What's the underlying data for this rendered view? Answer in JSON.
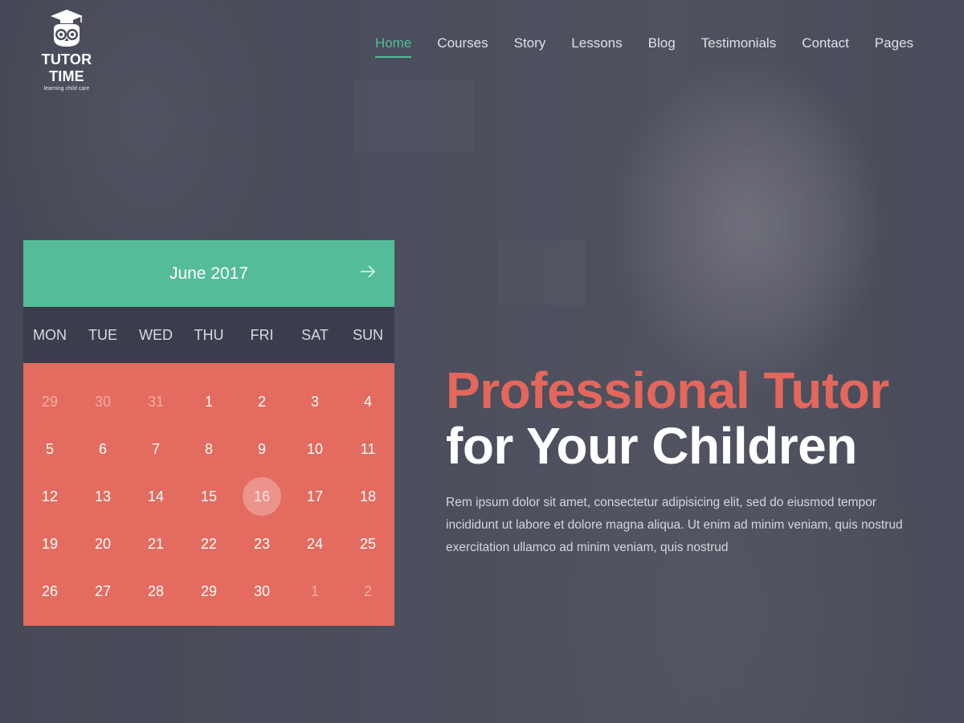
{
  "brand": {
    "title": "TUTOR TIME",
    "subtitle": "learning child care"
  },
  "nav": {
    "items": [
      {
        "label": "Home",
        "active": true
      },
      {
        "label": "Courses",
        "active": false
      },
      {
        "label": "Story",
        "active": false
      },
      {
        "label": "Lessons",
        "active": false
      },
      {
        "label": "Blog",
        "active": false
      },
      {
        "label": "Testimonials",
        "active": false
      },
      {
        "label": "Contact",
        "active": false
      },
      {
        "label": "Pages",
        "active": false
      }
    ]
  },
  "calendar": {
    "month_label": "June 2017",
    "next_icon": "arrow-right-icon",
    "weekdays": [
      "MON",
      "TUE",
      "WED",
      "THU",
      "FRI",
      "SAT",
      "SUN"
    ],
    "days": [
      {
        "n": "29",
        "muted": true
      },
      {
        "n": "30",
        "muted": true
      },
      {
        "n": "31",
        "muted": true
      },
      {
        "n": "1"
      },
      {
        "n": "2"
      },
      {
        "n": "3"
      },
      {
        "n": "4"
      },
      {
        "n": "5"
      },
      {
        "n": "6"
      },
      {
        "n": "7"
      },
      {
        "n": "8"
      },
      {
        "n": "9"
      },
      {
        "n": "10"
      },
      {
        "n": "11"
      },
      {
        "n": "12"
      },
      {
        "n": "13"
      },
      {
        "n": "14"
      },
      {
        "n": "15"
      },
      {
        "n": "16",
        "today": true
      },
      {
        "n": "17"
      },
      {
        "n": "18"
      },
      {
        "n": "19"
      },
      {
        "n": "20"
      },
      {
        "n": "21"
      },
      {
        "n": "22"
      },
      {
        "n": "23"
      },
      {
        "n": "24"
      },
      {
        "n": "25"
      },
      {
        "n": "26"
      },
      {
        "n": "27"
      },
      {
        "n": "28"
      },
      {
        "n": "29"
      },
      {
        "n": "30"
      },
      {
        "n": "1",
        "muted": true
      },
      {
        "n": "2",
        "muted": true
      }
    ]
  },
  "hero": {
    "title_line1": "Professional Tutor",
    "title_line2": "for Your Children",
    "body": "Rem ipsum dolor sit amet, consectetur adipisicing elit, sed do eiusmod tempor incididunt ut labore et dolore magna aliqua. Ut enim ad minim veniam, quis nostrud exercitation ullamco ad minim veniam, quis nostrud"
  },
  "colors": {
    "accent_green": "#54bd97",
    "accent_coral": "#e36b5f",
    "dark_band": "#3a3d4c"
  }
}
